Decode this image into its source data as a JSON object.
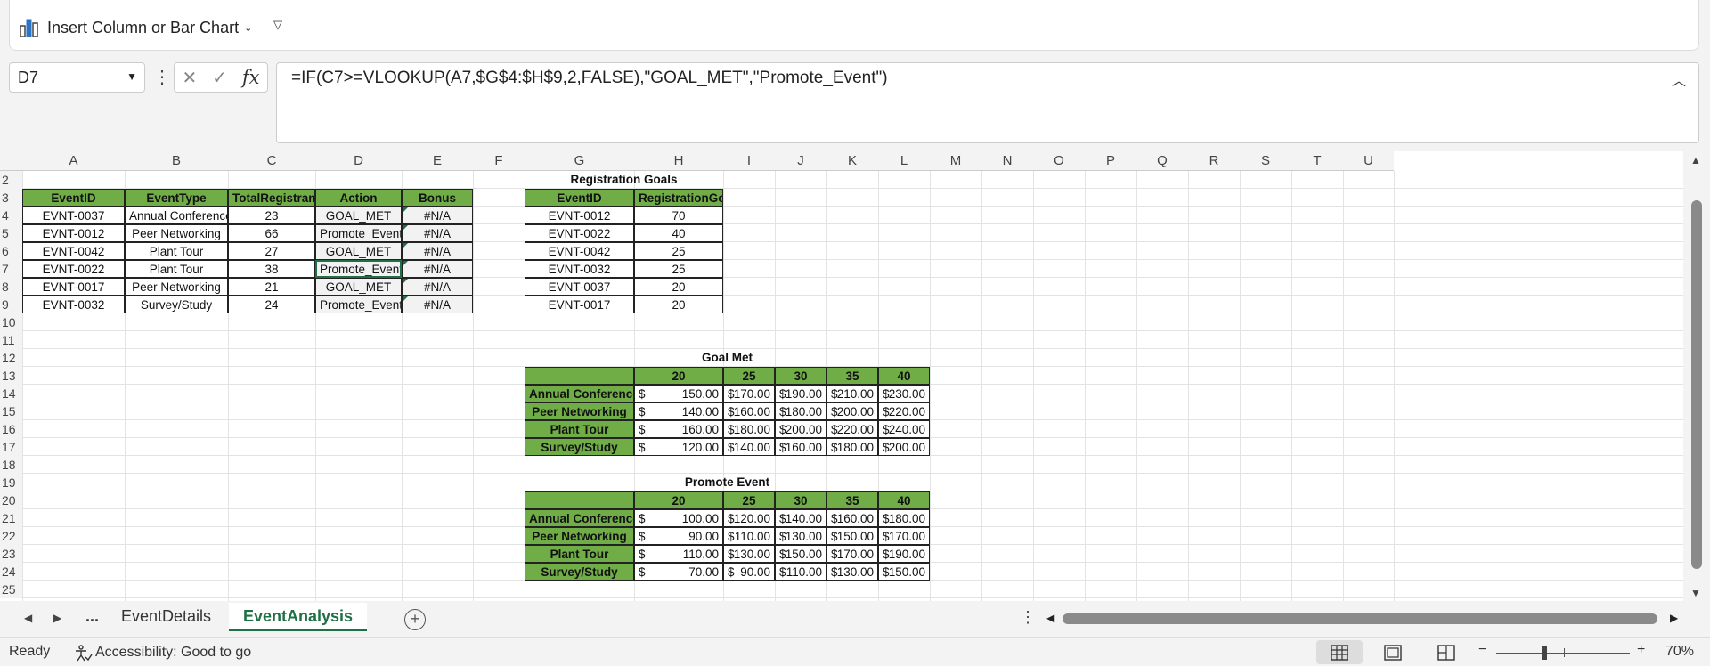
{
  "ribbon": {
    "chart_button_label": "Insert Column or Bar Chart"
  },
  "namebox": {
    "value": "D7"
  },
  "formula_bar": {
    "formula": "=IF(C7>=VLOOKUP(A7,$G$4:$H$9,2,FALSE),\"GOAL_MET\",\"Promote_Event\")"
  },
  "columns": [
    "A",
    "B",
    "C",
    "D",
    "E",
    "F",
    "G",
    "H",
    "I",
    "J",
    "K",
    "L",
    "M",
    "N",
    "O",
    "P",
    "Q",
    "R",
    "S",
    "T",
    "U"
  ],
  "rows": [
    "2",
    "3",
    "4",
    "5",
    "6",
    "7",
    "8",
    "9",
    "10",
    "11",
    "12",
    "13",
    "14",
    "15",
    "16",
    "17",
    "18",
    "19",
    "20",
    "21",
    "22",
    "23",
    "24",
    "25"
  ],
  "events_table": {
    "headers": [
      "EventID",
      "EventType",
      "TotalRegistrants",
      "Action",
      "Bonus"
    ],
    "rows": [
      [
        "EVNT-0037",
        "Annual Conference",
        "23",
        "GOAL_MET",
        "#N/A"
      ],
      [
        "EVNT-0012",
        "Peer Networking",
        "66",
        "Promote_Event",
        "#N/A"
      ],
      [
        "EVNT-0042",
        "Plant Tour",
        "27",
        "GOAL_MET",
        "#N/A"
      ],
      [
        "EVNT-0022",
        "Plant Tour",
        "38",
        "Promote_Event",
        "#N/A"
      ],
      [
        "EVNT-0017",
        "Peer Networking",
        "21",
        "GOAL_MET",
        "#N/A"
      ],
      [
        "EVNT-0032",
        "Survey/Study",
        "24",
        "Promote_Event",
        "#N/A"
      ]
    ]
  },
  "goals_table": {
    "title": "Registration Goals",
    "headers": [
      "EventID",
      "RegistrationGoal"
    ],
    "rows": [
      [
        "EVNT-0012",
        "70"
      ],
      [
        "EVNT-0022",
        "40"
      ],
      [
        "EVNT-0042",
        "25"
      ],
      [
        "EVNT-0032",
        "25"
      ],
      [
        "EVNT-0037",
        "20"
      ],
      [
        "EVNT-0017",
        "20"
      ]
    ]
  },
  "goal_met_table": {
    "title": "Goal Met",
    "headers": [
      "20",
      "25",
      "30",
      "35",
      "40"
    ],
    "rows": [
      {
        "label": "Annual Conference",
        "values": [
          "150.00",
          "170.00",
          "190.00",
          "210.00",
          "230.00"
        ]
      },
      {
        "label": "Peer Networking",
        "values": [
          "140.00",
          "160.00",
          "180.00",
          "200.00",
          "220.00"
        ]
      },
      {
        "label": "Plant Tour",
        "values": [
          "160.00",
          "180.00",
          "200.00",
          "220.00",
          "240.00"
        ]
      },
      {
        "label": "Survey/Study",
        "values": [
          "120.00",
          "140.00",
          "160.00",
          "180.00",
          "200.00"
        ]
      }
    ]
  },
  "promote_table": {
    "title": "Promote Event",
    "headers": [
      "20",
      "25",
      "30",
      "35",
      "40"
    ],
    "rows": [
      {
        "label": "Annual Conference",
        "values": [
          "100.00",
          "120.00",
          "140.00",
          "160.00",
          "180.00"
        ]
      },
      {
        "label": "Peer Networking",
        "values": [
          "90.00",
          "110.00",
          "130.00",
          "150.00",
          "170.00"
        ]
      },
      {
        "label": "Plant Tour",
        "values": [
          "110.00",
          "130.00",
          "150.00",
          "170.00",
          "190.00"
        ]
      },
      {
        "label": "Survey/Study",
        "values": [
          "70.00",
          "90.00",
          "110.00",
          "130.00",
          "150.00"
        ]
      }
    ]
  },
  "currency_symbol": "$",
  "tabs": {
    "ellipsis": "...",
    "sheet1": "EventDetails",
    "sheet2": "EventAnalysis"
  },
  "status": {
    "ready": "Ready",
    "accessibility": "Accessibility: Good to go",
    "zoom": "70%"
  },
  "colors": {
    "header_green": "#70ad47",
    "excel_green": "#1e7145"
  }
}
